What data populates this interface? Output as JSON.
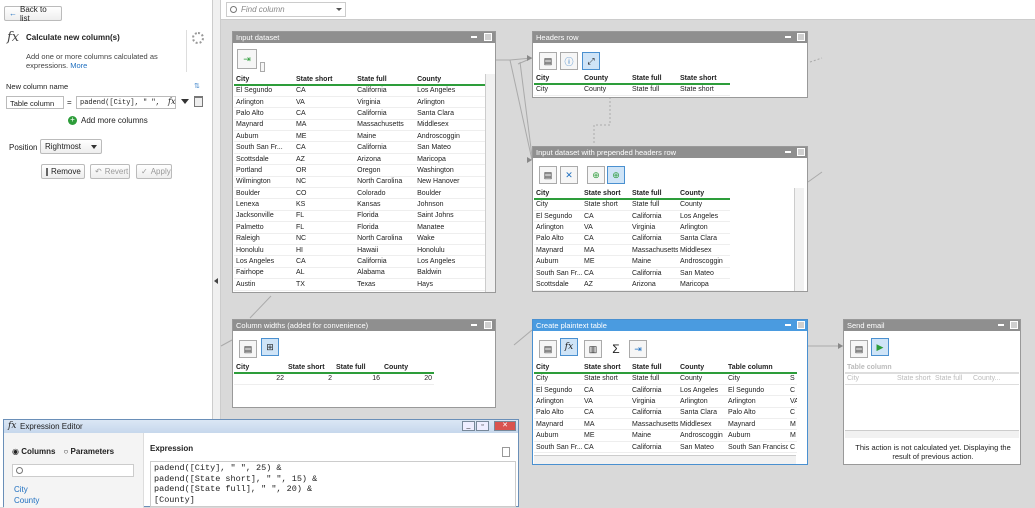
{
  "left": {
    "back": "Back to list",
    "title": "Calculate new column(s)",
    "desc": "Add one or more columns calculated as expressions.",
    "more": "More",
    "new_col_label": "New column name",
    "col_name": "Table column",
    "eq": "=",
    "expr": "padend([City], \" \",",
    "add_more": "Add more columns",
    "position_label": "Position",
    "position_value": "Rightmost",
    "remove": "Remove",
    "revert": "Revert",
    "apply": "Apply"
  },
  "search": {
    "placeholder": "Find column"
  },
  "boxes": {
    "input": {
      "title": "Input dataset",
      "cols": [
        "City",
        "State short",
        "State full",
        "County"
      ],
      "rows": [
        [
          "El Segundo",
          "CA",
          "California",
          "Los Angeles"
        ],
        [
          "Arlington",
          "VA",
          "Virginia",
          "Arlington"
        ],
        [
          "Palo Alto",
          "CA",
          "California",
          "Santa Clara"
        ],
        [
          "Maynard",
          "MA",
          "Massachusetts",
          "Middlesex"
        ],
        [
          "Auburn",
          "ME",
          "Maine",
          "Androscoggin"
        ],
        [
          "South San Fr...",
          "CA",
          "California",
          "San Mateo"
        ],
        [
          "Scottsdale",
          "AZ",
          "Arizona",
          "Maricopa"
        ],
        [
          "Portland",
          "OR",
          "Oregon",
          "Washington"
        ],
        [
          "Wilmington",
          "NC",
          "North Carolina",
          "New Hanover"
        ],
        [
          "Boulder",
          "CO",
          "Colorado",
          "Boulder"
        ],
        [
          "Lenexa",
          "KS",
          "Kansas",
          "Johnson"
        ],
        [
          "Jacksonville",
          "FL",
          "Florida",
          "Saint Johns"
        ],
        [
          "Palmetto",
          "FL",
          "Florida",
          "Manatee"
        ],
        [
          "Raleigh",
          "NC",
          "North Carolina",
          "Wake"
        ],
        [
          "Honolulu",
          "HI",
          "Hawaii",
          "Honolulu"
        ],
        [
          "Los Angeles",
          "CA",
          "California",
          "Los Angeles"
        ],
        [
          "Fairhope",
          "AL",
          "Alabama",
          "Baldwin"
        ],
        [
          "Austin",
          "TX",
          "Texas",
          "Hays"
        ]
      ]
    },
    "headers": {
      "title": "Headers row",
      "cols": [
        "City",
        "County",
        "State full",
        "State short"
      ],
      "rows": [
        [
          "City",
          "County",
          "State full",
          "State short"
        ]
      ]
    },
    "prepended": {
      "title": "Input dataset with prepended headers row",
      "cols": [
        "City",
        "State short",
        "State full",
        "County"
      ],
      "rows": [
        [
          "City",
          "State short",
          "State full",
          "County"
        ],
        [
          "El Segundo",
          "CA",
          "California",
          "Los Angeles"
        ],
        [
          "Arlington",
          "VA",
          "Virginia",
          "Arlington"
        ],
        [
          "Palo Alto",
          "CA",
          "California",
          "Santa Clara"
        ],
        [
          "Maynard",
          "MA",
          "Massachusetts",
          "Middlesex"
        ],
        [
          "Auburn",
          "ME",
          "Maine",
          "Androscoggin"
        ],
        [
          "South San Fr...",
          "CA",
          "California",
          "San Mateo"
        ],
        [
          "Scottsdale",
          "AZ",
          "Arizona",
          "Maricopa"
        ]
      ]
    },
    "widths": {
      "title": "Column widths (added for convenience)",
      "cols": [
        "City",
        "State short",
        "State full",
        "County"
      ],
      "rows": [
        [
          "22",
          "2",
          "16",
          "20"
        ]
      ]
    },
    "plaintext": {
      "title": "Create plaintext table",
      "cols": [
        "City",
        "State short",
        "State full",
        "County",
        "Table column",
        ""
      ],
      "rows": [
        [
          "City",
          "State short",
          "State full",
          "County",
          "City",
          "S"
        ],
        [
          "El Segundo",
          "CA",
          "California",
          "Los Angeles",
          "El Segundo",
          "C"
        ],
        [
          "Arlington",
          "VA",
          "Virginia",
          "Arlington",
          "Arlington",
          "VA"
        ],
        [
          "Palo Alto",
          "CA",
          "California",
          "Santa Clara",
          "Palo Alto",
          "C"
        ],
        [
          "Maynard",
          "MA",
          "Massachusetts",
          "Middlesex",
          "Maynard",
          "M"
        ],
        [
          "Auburn",
          "ME",
          "Maine",
          "Androscoggin",
          "Auburn",
          "M"
        ],
        [
          "South San Fr...",
          "CA",
          "California",
          "San Mateo",
          "South San Francisco",
          "C"
        ]
      ]
    },
    "email": {
      "title": "Send email",
      "cols": [
        "Table column",
        "",
        "",
        "",
        ""
      ],
      "rows": [
        [
          "City",
          "State short",
          "State full",
          "County...",
          ""
        ]
      ],
      "note": "This action is not calculated yet. Displaying the result of previous action."
    }
  },
  "editor": {
    "title": "Expression Editor",
    "tab_columns": "Columns",
    "tab_parameters": "Parameters",
    "expression_label": "Expression",
    "code": "padend([City], \" \", 25) &\npadend([State short], \" \", 15) &\npadend([State full], \" \", 20) &\n[County]",
    "list": [
      "City",
      "County"
    ]
  }
}
